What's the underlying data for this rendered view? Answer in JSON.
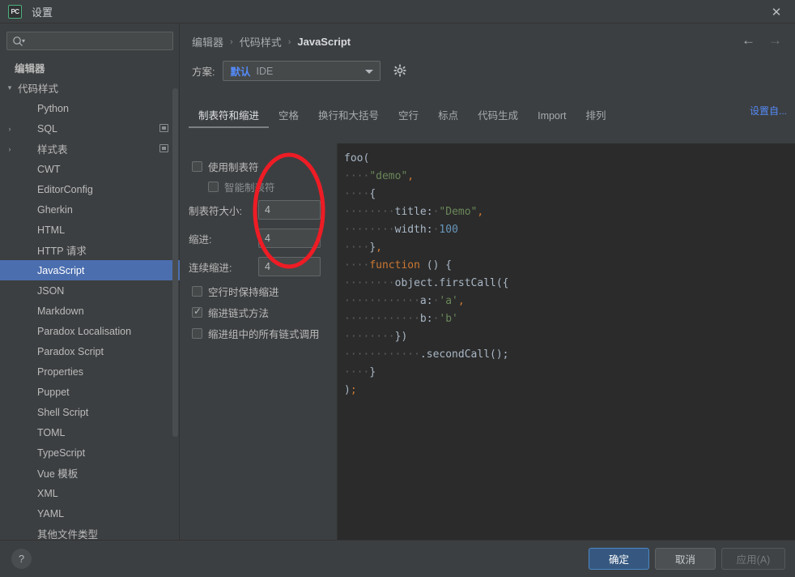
{
  "titlebar": {
    "app_logo": "PC",
    "title": "设置",
    "close_label": "✕",
    "close_icon": "close-icon"
  },
  "sidebar": {
    "search": {
      "value": "",
      "placeholder": "",
      "icon": "search-icon"
    },
    "tree": [
      {
        "label": "编辑器",
        "indent": 0,
        "arrow": "",
        "selected": false,
        "badge": false,
        "bold": true
      },
      {
        "label": "代码样式",
        "indent": 1,
        "arrow": "▾",
        "selected": false,
        "badge": false
      },
      {
        "label": "Python",
        "indent": 2,
        "arrow": "",
        "selected": false,
        "badge": false
      },
      {
        "label": "SQL",
        "indent": 2,
        "arrow": "›",
        "selected": false,
        "badge": true
      },
      {
        "label": "样式表",
        "indent": 2,
        "arrow": "›",
        "selected": false,
        "badge": true
      },
      {
        "label": "CWT",
        "indent": 2,
        "arrow": "",
        "selected": false,
        "badge": false
      },
      {
        "label": "EditorConfig",
        "indent": 2,
        "arrow": "",
        "selected": false,
        "badge": false
      },
      {
        "label": "Gherkin",
        "indent": 2,
        "arrow": "",
        "selected": false,
        "badge": false
      },
      {
        "label": "HTML",
        "indent": 2,
        "arrow": "",
        "selected": false,
        "badge": false
      },
      {
        "label": "HTTP 请求",
        "indent": 2,
        "arrow": "",
        "selected": false,
        "badge": false
      },
      {
        "label": "JavaScript",
        "indent": 2,
        "arrow": "",
        "selected": true,
        "badge": false
      },
      {
        "label": "JSON",
        "indent": 2,
        "arrow": "",
        "selected": false,
        "badge": false
      },
      {
        "label": "Markdown",
        "indent": 2,
        "arrow": "",
        "selected": false,
        "badge": false
      },
      {
        "label": "Paradox Localisation",
        "indent": 2,
        "arrow": "",
        "selected": false,
        "badge": false
      },
      {
        "label": "Paradox Script",
        "indent": 2,
        "arrow": "",
        "selected": false,
        "badge": false
      },
      {
        "label": "Properties",
        "indent": 2,
        "arrow": "",
        "selected": false,
        "badge": false
      },
      {
        "label": "Puppet",
        "indent": 2,
        "arrow": "",
        "selected": false,
        "badge": false
      },
      {
        "label": "Shell Script",
        "indent": 2,
        "arrow": "",
        "selected": false,
        "badge": false
      },
      {
        "label": "TOML",
        "indent": 2,
        "arrow": "",
        "selected": false,
        "badge": false
      },
      {
        "label": "TypeScript",
        "indent": 2,
        "arrow": "",
        "selected": false,
        "badge": false
      },
      {
        "label": "Vue 模板",
        "indent": 2,
        "arrow": "",
        "selected": false,
        "badge": false
      },
      {
        "label": "XML",
        "indent": 2,
        "arrow": "",
        "selected": false,
        "badge": false
      },
      {
        "label": "YAML",
        "indent": 2,
        "arrow": "",
        "selected": false,
        "badge": false
      },
      {
        "label": "其他文件类型",
        "indent": 2,
        "arrow": "",
        "selected": false,
        "badge": false
      }
    ]
  },
  "content": {
    "breadcrumb": {
      "items": [
        "编辑器",
        "代码样式",
        "JavaScript"
      ],
      "separator": "›"
    },
    "nav": {
      "back_icon": "arrow-left-icon",
      "forward_icon": "arrow-right-icon",
      "back": "←",
      "forward": "→"
    },
    "config_link": "设置自...",
    "scheme": {
      "label": "方案:",
      "value": "默认",
      "subvalue": "IDE",
      "gear_icon": "gear-icon"
    },
    "tabs": [
      {
        "label": "制表符和缩进",
        "active": true
      },
      {
        "label": "空格",
        "active": false
      },
      {
        "label": "换行和大括号",
        "active": false
      },
      {
        "label": "空行",
        "active": false
      },
      {
        "label": "标点",
        "active": false
      },
      {
        "label": "代码生成",
        "active": false
      },
      {
        "label": "Import",
        "active": false
      },
      {
        "label": "排列",
        "active": false
      }
    ],
    "settings": {
      "use_tab_char": {
        "label": "使用制表符",
        "checked": false
      },
      "smart_tabs": {
        "label": "智能制表符",
        "checked": false,
        "disabled": true
      },
      "tab_size": {
        "label": "制表符大小:",
        "value": "4"
      },
      "indent": {
        "label": "缩进:",
        "value": "4"
      },
      "continuation_indent": {
        "label": "连续缩进:",
        "value": "4"
      },
      "keep_indents_on_empty_lines": {
        "label": "空行时保持缩进",
        "checked": false
      },
      "indent_chained_methods": {
        "label": "缩进链式方法",
        "checked": true
      },
      "indent_all_chained_calls": {
        "label": "缩进组中的所有链式调用",
        "checked": false
      }
    },
    "code_preview": {
      "language": "JavaScript",
      "lines": [
        [
          {
            "t": "foo(",
            "c": "def"
          }
        ],
        [
          {
            "t": "····",
            "c": "ws"
          },
          {
            "t": "\"demo\"",
            "c": "str"
          },
          {
            "t": ",",
            "c": "punct"
          }
        ],
        [
          {
            "t": "····",
            "c": "ws"
          },
          {
            "t": "{",
            "c": "brace"
          }
        ],
        [
          {
            "t": "········",
            "c": "ws"
          },
          {
            "t": "title:",
            "c": "def"
          },
          {
            "t": "·",
            "c": "ws"
          },
          {
            "t": "\"Demo\"",
            "c": "str"
          },
          {
            "t": ",",
            "c": "punct"
          }
        ],
        [
          {
            "t": "········",
            "c": "ws"
          },
          {
            "t": "width:",
            "c": "def"
          },
          {
            "t": "·",
            "c": "ws"
          },
          {
            "t": "100",
            "c": "num"
          }
        ],
        [
          {
            "t": "····",
            "c": "ws"
          },
          {
            "t": "}",
            "c": "brace"
          },
          {
            "t": ",",
            "c": "punct"
          }
        ],
        [
          {
            "t": "····",
            "c": "ws"
          },
          {
            "t": "function",
            "c": "kw"
          },
          {
            "t": " () {",
            "c": "def"
          }
        ],
        [
          {
            "t": "········",
            "c": "ws"
          },
          {
            "t": "object.firstCall({",
            "c": "def"
          }
        ],
        [
          {
            "t": "············",
            "c": "ws"
          },
          {
            "t": "a:",
            "c": "def"
          },
          {
            "t": "·",
            "c": "ws"
          },
          {
            "t": "'a'",
            "c": "str"
          },
          {
            "t": ",",
            "c": "punct"
          }
        ],
        [
          {
            "t": "············",
            "c": "ws"
          },
          {
            "t": "b:",
            "c": "def"
          },
          {
            "t": "·",
            "c": "ws"
          },
          {
            "t": "'b'",
            "c": "str"
          }
        ],
        [
          {
            "t": "········",
            "c": "ws"
          },
          {
            "t": "})",
            "c": "def"
          }
        ],
        [
          {
            "t": "············",
            "c": "ws"
          },
          {
            "t": ".secondCall();",
            "c": "def"
          }
        ],
        [
          {
            "t": "····",
            "c": "ws"
          },
          {
            "t": "}",
            "c": "brace"
          }
        ],
        [
          {
            "t": ")",
            "c": "def"
          },
          {
            "t": ";",
            "c": "punct"
          }
        ]
      ]
    }
  },
  "annotation": {
    "shape": "ellipse",
    "color": "#ee1c25",
    "target": "indent-number-fields"
  },
  "footer": {
    "help_label": "?",
    "help_icon": "help-icon",
    "ok": "确定",
    "cancel": "取消",
    "apply": "应用(A)"
  }
}
